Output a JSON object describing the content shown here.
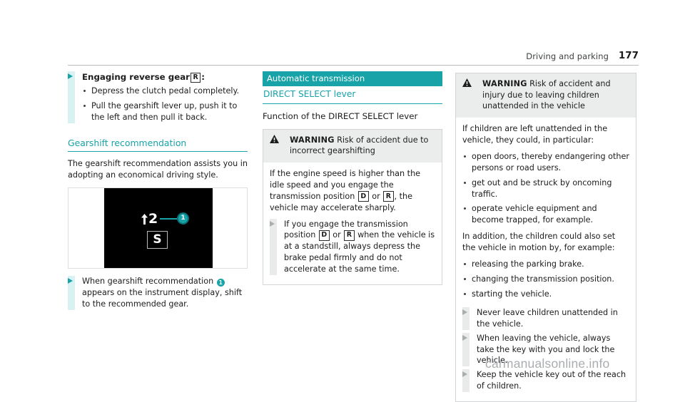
{
  "header": {
    "section_title": "Driving and parking",
    "page_number": "177",
    "rule_color": "#b9bcbe"
  },
  "theme": {
    "teal": "#17a3a8",
    "teal_pale": "#d8f2f3",
    "warning_head_bg": "#ebecec",
    "warning_border": "#d2d4d5",
    "gray_arrow": "#a9adad"
  },
  "left_column": {
    "action_reverse": {
      "lead_bold": "Engaging reverse gear",
      "key": "R",
      "trail": ":",
      "bullets": [
        "Depress the clutch pedal completely.",
        "Pull the gearshift lever up, push it to the left and then pull it back."
      ]
    },
    "gearshift_section": {
      "title": "Gearshift recommendation",
      "paragraph": "The gearshift recommendation assists you in adopting an economical driving style."
    },
    "figure": {
      "name": "instrument-display-gearshift-recommendation",
      "gear_number": "2",
      "callout_number": "1",
      "mode_letter": "S",
      "up_arrow_icon": "up-arrow-icon"
    },
    "action_recommendation": {
      "text_before": "When gearshift recommendation",
      "badge": "1",
      "text_after": "appears on the instrument display, shift to the recommended gear."
    }
  },
  "middle_column": {
    "chapter_bar": "Automatic transmission",
    "sub_head": "DIRECT SELECT lever",
    "body_head": "Function of the DIRECT SELECT lever",
    "warning": {
      "icon": "warning-triangle-icon",
      "word": "WARNING",
      "title": "Risk of accident due to incorrect gearshifting",
      "para_1_a": "If the engine speed is higher than the idle speed and you engage the transmission position",
      "para_1_key_1": "D",
      "para_1_or": "or",
      "para_1_key_2": "R",
      "para_1_b": ", the vehicle may accelerate sharply.",
      "action_a": "If you engage the transmission position",
      "action_key_1": "D",
      "action_or": "or",
      "action_key_2": "R",
      "action_b": "when the vehicle is at a standstill, always depress the brake pedal firmly and do not accelerate at the same time."
    }
  },
  "right_column": {
    "warning": {
      "icon": "warning-triangle-icon",
      "word": "WARNING",
      "title": "Risk of accident and injury due to leaving children unattended in the vehicle",
      "intro": "If children are left unattended in the vehicle, they could, in particular:",
      "bullets_1": [
        "open doors, thereby endangering other persons or road users.",
        "get out and be struck by oncoming traffic.",
        "operate vehicle equipment and become trapped, for example."
      ],
      "intro_2": "In addition, the children could also set the vehicle in motion by, for example:",
      "bullets_2": [
        "releasing the parking brake.",
        "changing the transmission position.",
        "starting the vehicle."
      ],
      "actions": [
        "Never leave children unattended in the vehicle.",
        "When leaving the vehicle, always take the key with you and lock the vehicle.",
        "Keep the vehicle key out of the reach of children."
      ]
    }
  },
  "watermark": "carmanualsonline.info"
}
